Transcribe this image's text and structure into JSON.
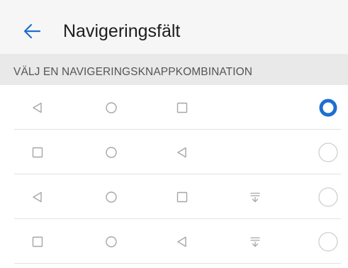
{
  "header": {
    "title": "Navigeringsfält",
    "back_icon": "arrow-left-icon"
  },
  "section": {
    "title": "VÄLJ EN NAVIGERINGSKNAPPKOMBINATION"
  },
  "options": [
    {
      "buttons": [
        "back-triangle-icon",
        "home-circle-icon",
        "recents-square-icon"
      ],
      "selected": true
    },
    {
      "buttons": [
        "recents-square-icon",
        "home-circle-icon",
        "back-triangle-icon"
      ],
      "selected": false
    },
    {
      "buttons": [
        "back-triangle-icon",
        "home-circle-icon",
        "recents-square-icon",
        "notification-pull-icon"
      ],
      "selected": false
    },
    {
      "buttons": [
        "recents-square-icon",
        "home-circle-icon",
        "back-triangle-icon",
        "notification-pull-icon"
      ],
      "selected": false
    }
  ],
  "colors": {
    "accent": "#1e6fd0",
    "icon": "#a6a6a6",
    "header_bg": "#f6f6f6",
    "section_bg": "#e9e9e9"
  }
}
